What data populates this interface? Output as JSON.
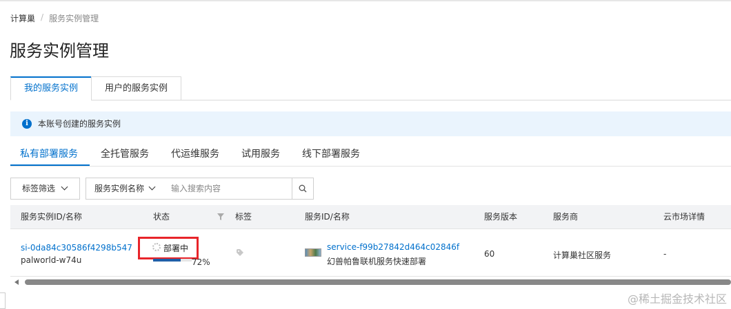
{
  "breadcrumb": {
    "root": "计算巢",
    "sep": "/",
    "current": "服务实例管理"
  },
  "page_title": "服务实例管理",
  "top_tabs": [
    {
      "label": "我的服务实例",
      "active": true
    },
    {
      "label": "用户的服务实例",
      "active": false
    }
  ],
  "info": {
    "icon": "info-icon",
    "text": "本账号创建的服务实例"
  },
  "sub_tabs": [
    {
      "label": "私有部署服务",
      "active": true
    },
    {
      "label": "全托管服务",
      "active": false
    },
    {
      "label": "代运维服务",
      "active": false
    },
    {
      "label": "试用服务",
      "active": false
    },
    {
      "label": "线下部署服务",
      "active": false
    }
  ],
  "filters": {
    "tag_filter": "标签筛选",
    "field_select": "服务实例名称",
    "search_placeholder": "输入搜索内容"
  },
  "table": {
    "columns": [
      "服务实例ID/名称",
      "状态",
      "标签",
      "服务ID/名称",
      "服务版本",
      "服务商",
      "云市场详情"
    ],
    "rows": [
      {
        "instance_id": "si-0da84c30586f4298b547",
        "instance_name": "palworld-w74u",
        "status": "部署中",
        "progress_label": "72%",
        "progress": 0.72,
        "service_id": "service-f99b27842d464c02846f",
        "service_name": "幻兽帕鲁联机服务快速部署",
        "version": "60",
        "provider": "计算巢社区服务",
        "marketplace": "-"
      }
    ]
  },
  "watermark": "@稀土掘金技术社区",
  "colors": {
    "accent": "#0070cc",
    "highlight": "#e8242a",
    "info_bg": "#eaf4fd"
  }
}
